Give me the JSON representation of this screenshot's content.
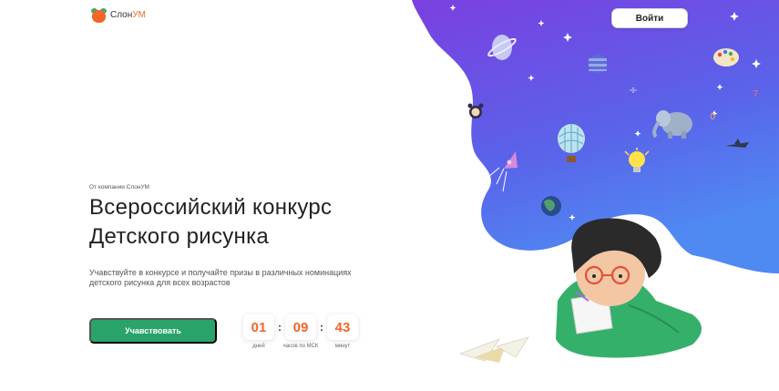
{
  "header": {
    "logo_prefix": "Слон",
    "logo_accent": "УМ",
    "login_label": "Войти"
  },
  "hero": {
    "eyebrow": "От компании СлонУМ",
    "title_line1": "Всероссийский конкурс",
    "title_line2": "Детского рисунка",
    "subtitle": "Учавствуйте в конкурсе и получайте призы в различных номинациях детского рисунка для всех возрастов",
    "cta_label": "Учавствовать"
  },
  "timer": {
    "days": "01",
    "days_label": "дней",
    "hours": "09",
    "hours_label": "часов по МСК",
    "minutes": "43",
    "minutes_label": "минут",
    "separator": ":"
  },
  "colors": {
    "brand_orange": "#f2662a",
    "brand_green": "#29a36a",
    "blob_gradient_start": "#7b3fe0",
    "blob_gradient_end": "#4f7ef2"
  },
  "icons": [
    "logo-elephant-icon",
    "planet-icon",
    "rocket-icon",
    "hot-air-balloon-icon",
    "lightbulb-icon",
    "elephant-icon",
    "palette-icon",
    "alarm-clock-icon",
    "plane-icon",
    "star-icon",
    "paper-plane-icon"
  ]
}
